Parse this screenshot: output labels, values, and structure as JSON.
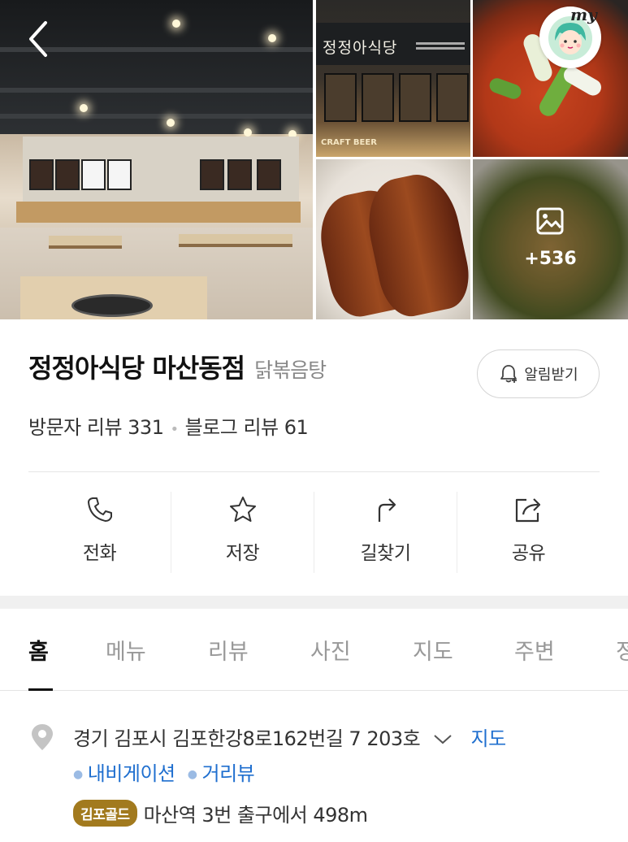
{
  "gallery": {
    "sign_text": "정정아식당",
    "craft_text": "CRAFT BEER",
    "more_photos": "+536"
  },
  "header": {
    "my_label": "my"
  },
  "place": {
    "name": "정정아식당 마산동점",
    "category": "닭볶음탕",
    "alarm_label": "알림받기",
    "visitor_reviews": "방문자 리뷰 331",
    "blog_reviews": "블로그 리뷰 61"
  },
  "actions": [
    {
      "label": "전화",
      "icon": "phone-icon"
    },
    {
      "label": "저장",
      "icon": "star-icon"
    },
    {
      "label": "길찾기",
      "icon": "directions-icon"
    },
    {
      "label": "공유",
      "icon": "share-icon"
    }
  ],
  "tabs": [
    "홈",
    "메뉴",
    "리뷰",
    "사진",
    "지도",
    "주변",
    "정"
  ],
  "active_tab": "홈",
  "info": {
    "address": "경기 김포시 김포한강8로162번길 7 203호",
    "map_link": "지도",
    "navigation_link": "내비게이션",
    "streetview_link": "거리뷰",
    "subway_line": "김포골드",
    "subway_text": "마산역 3번 출구에서 498m"
  },
  "colors": {
    "link": "#1f6fcf",
    "subway_badge": "#a27a1e"
  }
}
